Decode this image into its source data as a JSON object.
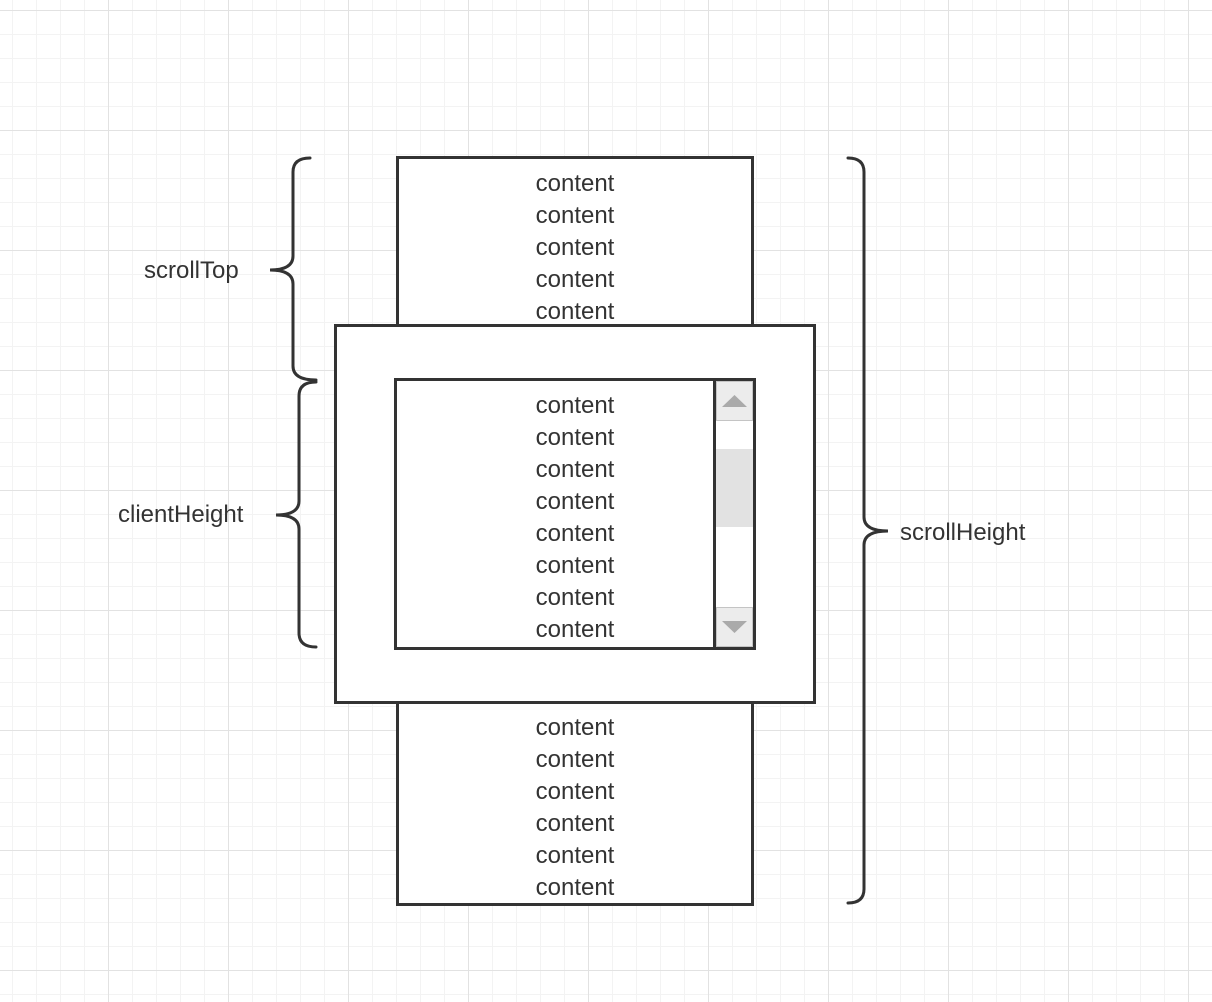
{
  "labels": {
    "scroll_top": "scrollTop",
    "client_height": "clientHeight",
    "scroll_height": "scrollHeight"
  },
  "content_above": {
    "items": [
      "content",
      "content",
      "content",
      "content",
      "content"
    ]
  },
  "content_visible": {
    "items": [
      "content",
      "content",
      "content",
      "content",
      "content",
      "content",
      "content",
      "content"
    ]
  },
  "content_below": {
    "items": [
      "content",
      "content",
      "content",
      "content",
      "content",
      "content"
    ]
  },
  "scrollbar": {
    "up_icon": "triangle-up",
    "down_icon": "triangle-down",
    "thumb_color": "#e2e2e2"
  },
  "colors": {
    "stroke": "#333333",
    "grid_major": "#e2e2e2",
    "grid_minor": "#f3f3f3"
  }
}
